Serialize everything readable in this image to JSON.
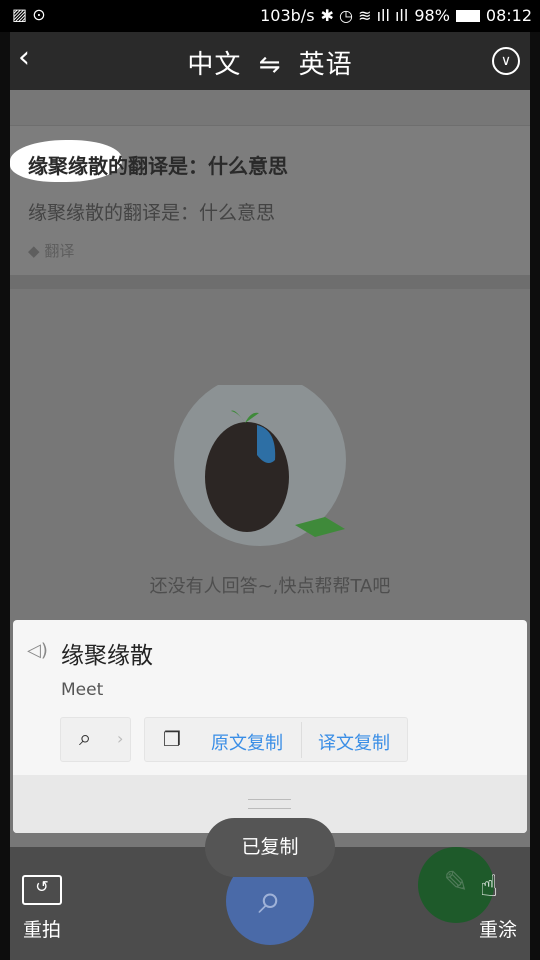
{
  "status_bar": {
    "speed": "103b/s",
    "battery": "98%",
    "time": "08:12"
  },
  "title_bar": {
    "source_lang": "中文",
    "swap_symbol": "⇋",
    "target_lang": "英语"
  },
  "background_page": {
    "question_title": "缘聚缘散的翻译是：什么意思",
    "question_body": "缘聚缘散的翻译是：什么意思",
    "tag": "翻译",
    "empty_text": "还没有人回答~,快点帮帮TA吧"
  },
  "result_card": {
    "source_text": "缘聚缘散",
    "translation": "Meet",
    "copy_source_label": "原文复制",
    "copy_translation_label": "译文复制"
  },
  "toast": "已复制",
  "bottom_bar": {
    "retake_label": "重拍",
    "redraw_label": "重涂"
  },
  "colors": {
    "accent_blue": "#3a8ee6",
    "search_button": "#4a6aa8",
    "edit_button": "#1e5a2a"
  }
}
